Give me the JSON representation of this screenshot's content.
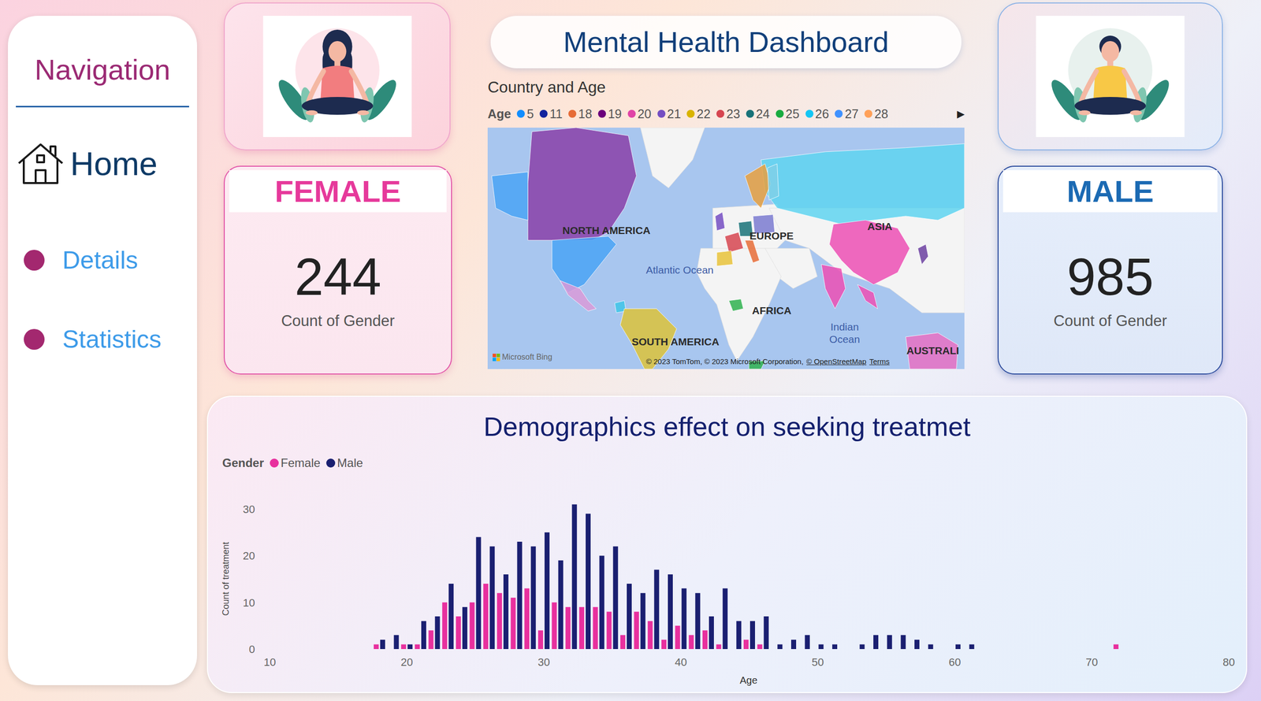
{
  "navigation": {
    "title": "Navigation",
    "items": [
      {
        "label": "Home",
        "selected": true
      },
      {
        "label": "Details",
        "selected": false
      },
      {
        "label": "Statistics",
        "selected": false
      }
    ]
  },
  "header": {
    "title": "Mental Health Dashboard"
  },
  "cards": [
    {
      "kind": "female",
      "label": "FEMALE",
      "value": "244",
      "caption": "Count of Gender",
      "color": "#e6399b"
    },
    {
      "kind": "male",
      "label": "MALE",
      "value": "985",
      "caption": "Count of Gender",
      "color": "#1b6ab3"
    }
  ],
  "map": {
    "title": "Country and Age",
    "legend_title": "Age",
    "legend": [
      {
        "label": "5",
        "color": "#118dff"
      },
      {
        "label": "11",
        "color": "#12239e"
      },
      {
        "label": "18",
        "color": "#e66c37"
      },
      {
        "label": "19",
        "color": "#6b007b"
      },
      {
        "label": "20",
        "color": "#e044a7"
      },
      {
        "label": "21",
        "color": "#744ec2"
      },
      {
        "label": "22",
        "color": "#d9b300"
      },
      {
        "label": "23",
        "color": "#d64550"
      },
      {
        "label": "24",
        "color": "#197278"
      },
      {
        "label": "25",
        "color": "#1aab40"
      },
      {
        "label": "26",
        "color": "#15c6f4"
      },
      {
        "label": "27",
        "color": "#4092ff"
      },
      {
        "label": "28",
        "color": "#ffa058"
      }
    ],
    "legend_more": "▶",
    "labels": [
      {
        "text": "NORTH AMERICA",
        "kind": "continent"
      },
      {
        "text": "EUROPE",
        "kind": "continent"
      },
      {
        "text": "ASIA",
        "kind": "continent"
      },
      {
        "text": "Atlantic Ocean",
        "kind": "ocean"
      },
      {
        "text": "AFRICA",
        "kind": "continent"
      },
      {
        "text": "SOUTH AMERICA",
        "kind": "continent"
      },
      {
        "text": "Indian Ocean",
        "kind": "ocean"
      },
      {
        "text": "AUSTRALI",
        "kind": "continent"
      }
    ],
    "regions": [
      {
        "color": "#8a3fa8"
      },
      {
        "color": "#4aa3f5"
      },
      {
        "color": "#4aa3f5"
      },
      {
        "color": "#d99ad8"
      },
      {
        "color": "#3fc4e8"
      },
      {
        "color": "#dcc23a"
      },
      {
        "color": "#5fd4f0"
      },
      {
        "color": "#ec4fb4"
      },
      {
        "color": "#ec4fb4"
      },
      {
        "color": "#ec4fb4"
      },
      {
        "color": "#6b3fa0"
      },
      {
        "color": "#2fb24f"
      },
      {
        "color": "#2fb24f"
      },
      {
        "color": "#e870c3"
      },
      {
        "color": "#e8a040"
      },
      {
        "color": "#7fd0e8"
      },
      {
        "color": "#744ec2"
      },
      {
        "color": "#d64550"
      },
      {
        "color": "#e8c23a"
      },
      {
        "color": "#197278"
      },
      {
        "color": "#e66c37"
      },
      {
        "color": "#7a7ad0"
      }
    ],
    "brand": "Microsoft Bing",
    "attribution": [
      {
        "text": "© 2023 TomTom, © 2023 Microsoft Corporation,",
        "link": false
      },
      {
        "text": "© OpenStreetMap",
        "link": true
      },
      {
        "text": "Terms",
        "link": true
      }
    ]
  },
  "chart": {
    "title": "Demographics effect on seeking treatmet",
    "legend_title": "Gender",
    "y_axis": {
      "title": "Count of treatment",
      "ticks": [
        "0",
        "10",
        "20",
        "30"
      ]
    },
    "x_axis": {
      "title": "Age",
      "ticks": [
        "10",
        "20",
        "30",
        "40",
        "50",
        "60",
        "70",
        "80"
      ]
    },
    "categories": [
      18,
      19,
      20,
      21,
      22,
      23,
      24,
      25,
      26,
      27,
      28,
      29,
      30,
      31,
      32,
      33,
      34,
      35,
      36,
      37,
      38,
      39,
      40,
      41,
      42,
      43,
      44,
      45,
      46,
      47,
      48,
      49,
      50,
      51,
      53,
      54,
      55,
      56,
      57,
      58,
      60,
      61,
      72
    ],
    "series": [
      {
        "name": "Female",
        "color": "#e8309e",
        "values": [
          1,
          0,
          1,
          1,
          4,
          10,
          7,
          10,
          14,
          12,
          11,
          13,
          4,
          10,
          9,
          9,
          9,
          8,
          3,
          8,
          6,
          2,
          5,
          3,
          4,
          1,
          0,
          2,
          1,
          0,
          0,
          0,
          0,
          0,
          0,
          0,
          0,
          0,
          0,
          0,
          0,
          0,
          1
        ]
      },
      {
        "name": "Male",
        "color": "#1a1f71",
        "values": [
          2,
          3,
          1,
          6,
          7,
          14,
          9,
          24,
          22,
          16,
          23,
          22,
          25,
          19,
          31,
          29,
          20,
          22,
          14,
          12,
          17,
          16,
          13,
          12,
          7,
          13,
          6,
          6,
          7,
          1,
          2,
          3,
          1,
          1,
          1,
          3,
          3,
          3,
          2,
          1,
          1,
          1,
          0
        ]
      }
    ]
  }
}
